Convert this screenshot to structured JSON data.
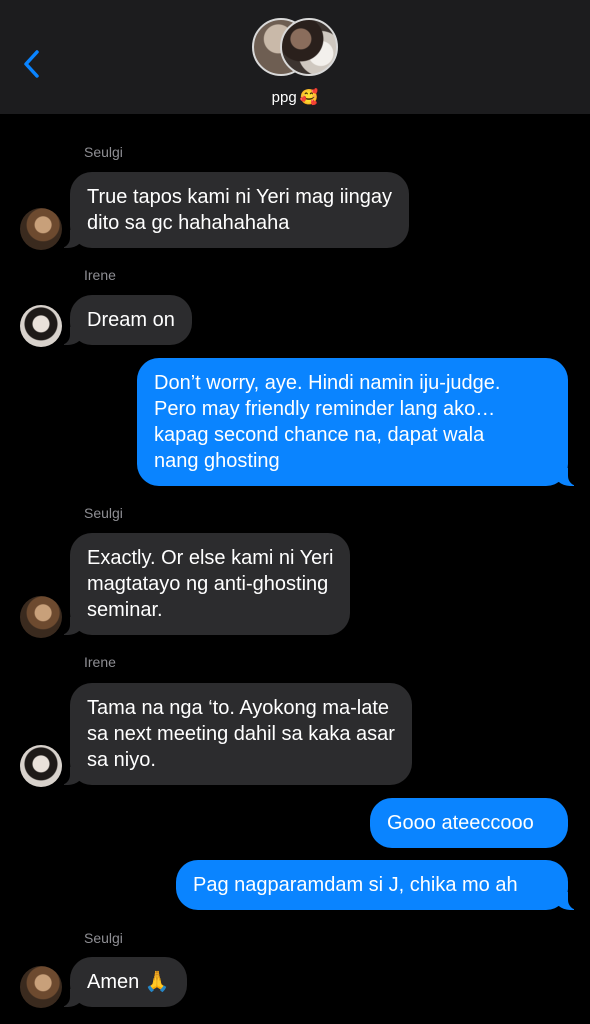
{
  "header": {
    "group_name": "ppg",
    "group_emoji": "🥰",
    "back_icon": "chevron-left-icon",
    "accent": "#0a84ff"
  },
  "messages": [
    {
      "sender": "Seulgi",
      "text": "True tapos kami ni Yeri mag iingay\ndito sa gc hahahahaha"
    },
    {
      "sender": "Irene",
      "text": "Dream on"
    },
    {
      "sender": "me",
      "text": "Don’t worry, aye. Hindi namin iju-judge.\nPero may friendly reminder lang ako…\nkapag second chance na, dapat wala\nnang ghosting"
    },
    {
      "sender": "Seulgi",
      "text": "Exactly. Or else kami ni Yeri\nmagtatayo ng anti-ghosting\nseminar."
    },
    {
      "sender": "Irene",
      "text": "Tama na nga ‘to. Ayokong ma-late\nsa next meeting dahil sa kaka asar\nsa niyo."
    },
    {
      "sender": "me",
      "text": "Gooo ateeccooo"
    },
    {
      "sender": "me",
      "text": "Pag nagparamdam si J, chika mo ah"
    },
    {
      "sender": "Seulgi",
      "text": "Amen 🙏"
    }
  ]
}
